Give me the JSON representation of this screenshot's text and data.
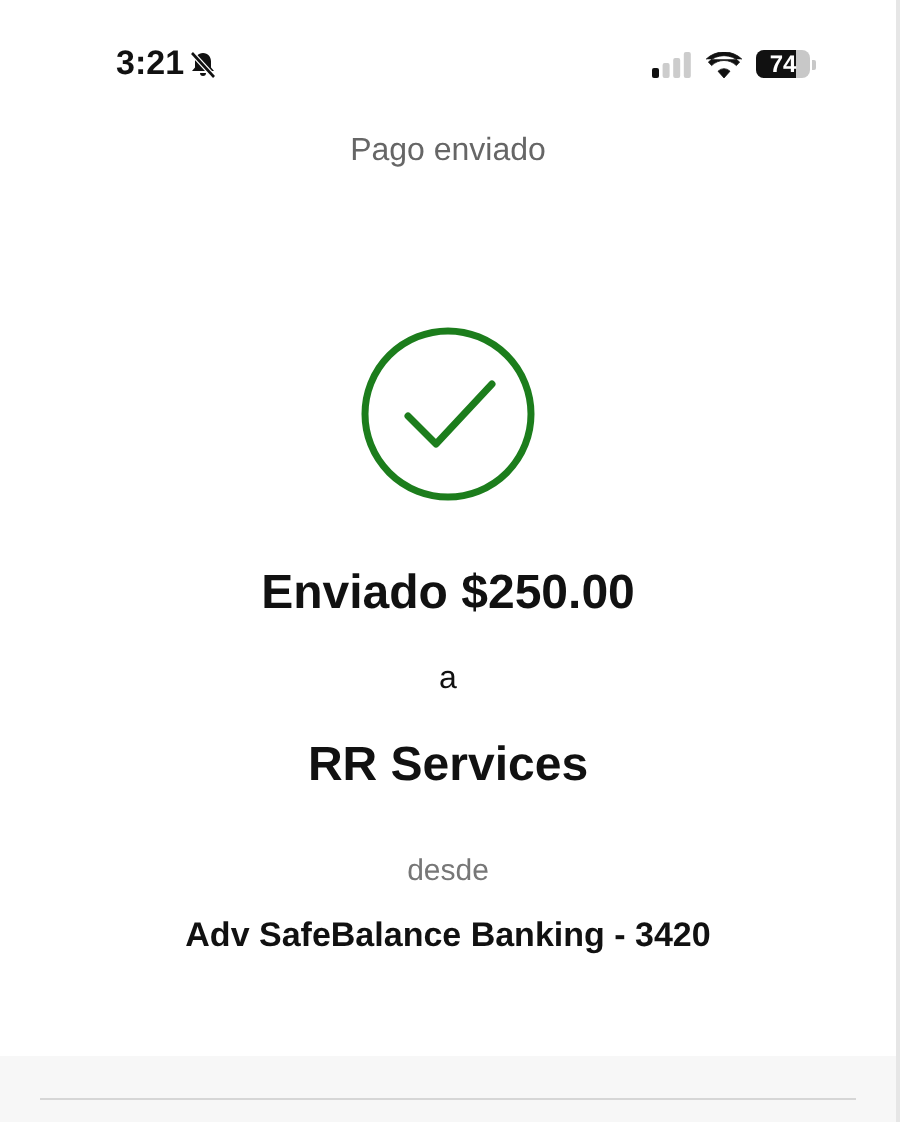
{
  "status_bar": {
    "time": "3:21",
    "battery": "74"
  },
  "header": {
    "title": "Pago enviado"
  },
  "confirmation": {
    "amount_line": "Enviado $250.00",
    "connector": "a",
    "recipient": "RR Services",
    "from_label": "desde",
    "account": "Adv SafeBalance Banking - 3420"
  }
}
